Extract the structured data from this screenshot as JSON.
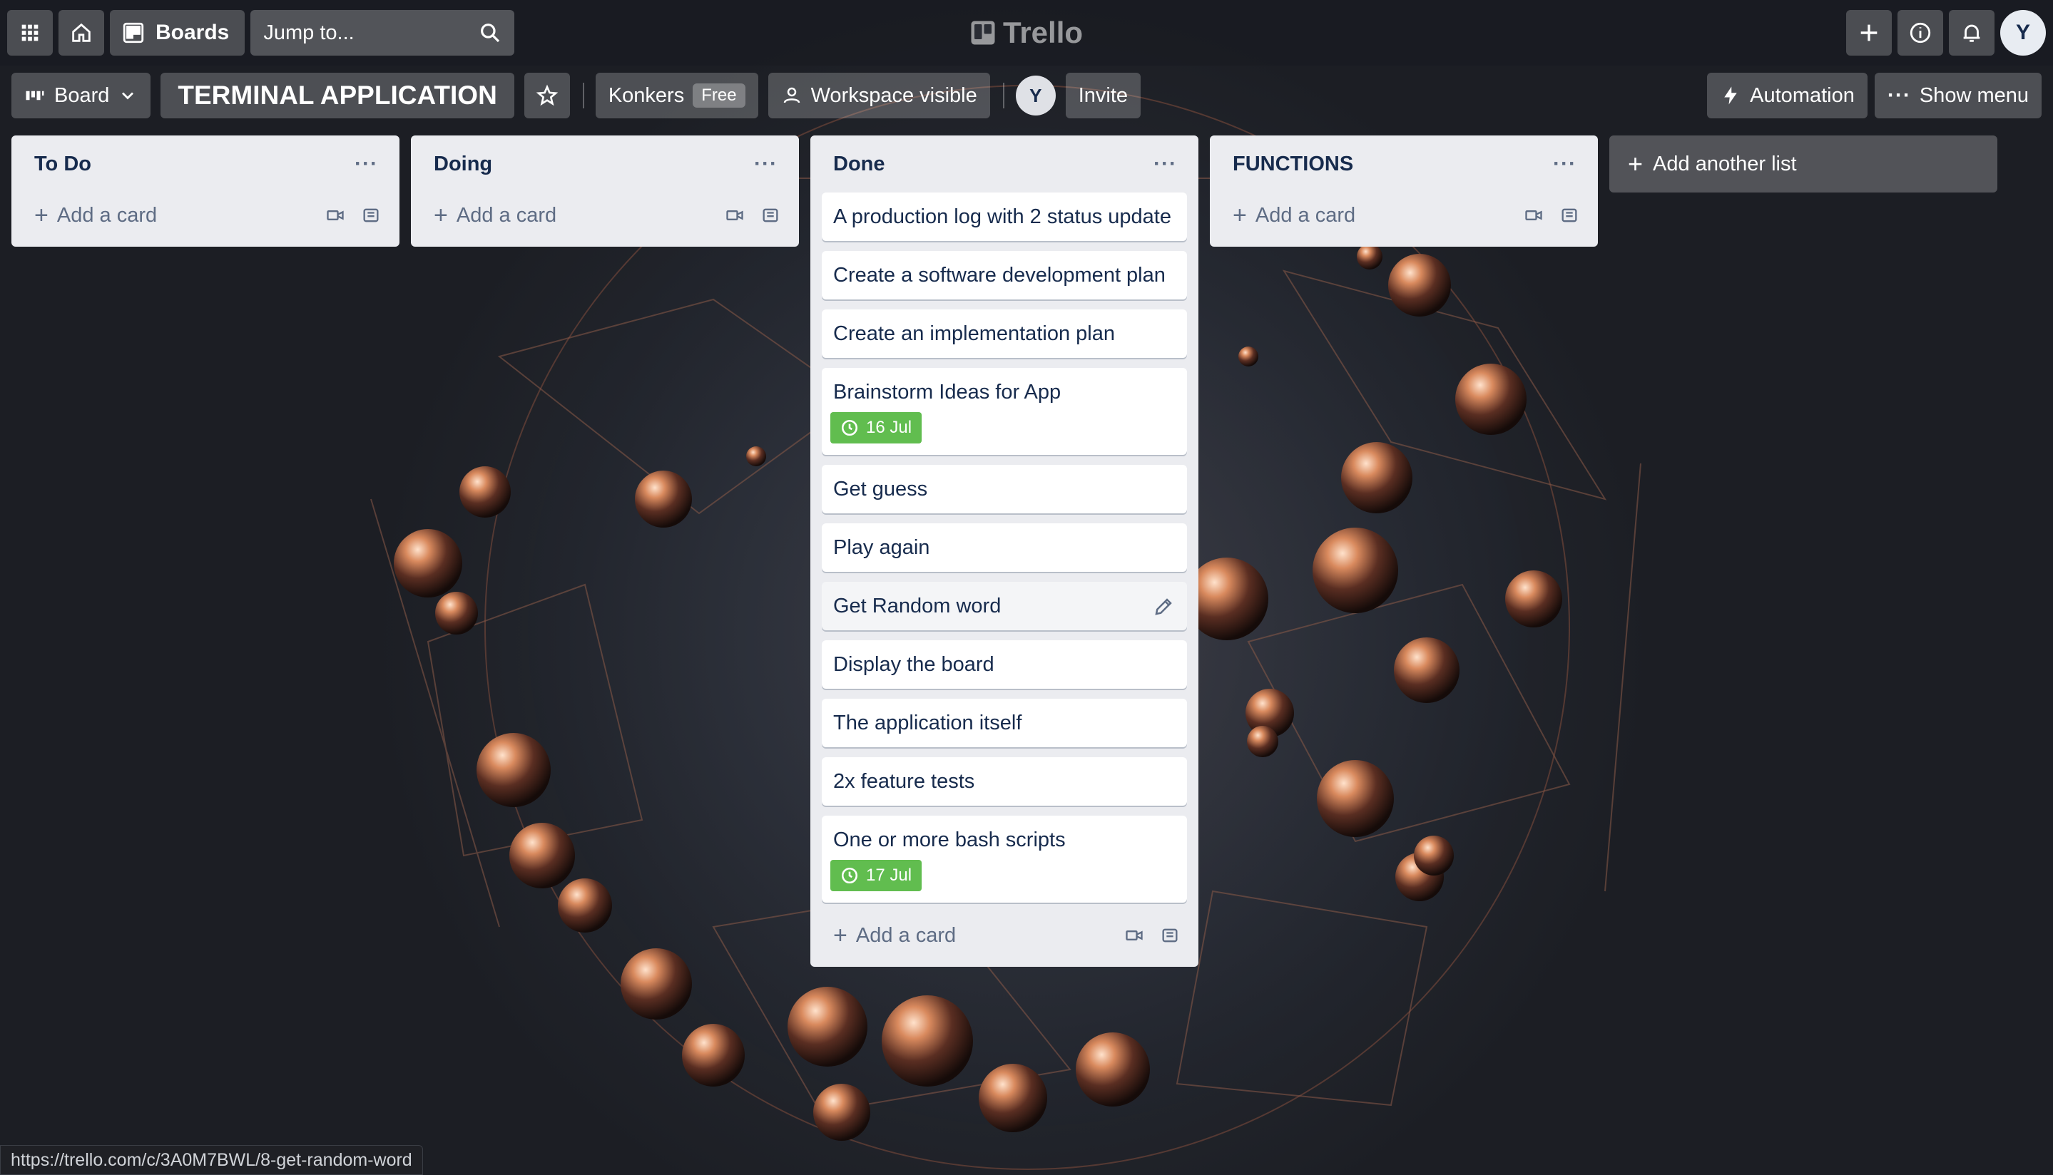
{
  "topbar": {
    "boards_label": "Boards",
    "search_placeholder": "Jump to...",
    "logo_text": "Trello",
    "user_initial": "Y"
  },
  "board": {
    "view_label": "Board",
    "title": "TERMINAL APPLICATION",
    "workspace_name": "Konkers",
    "workspace_plan": "Free",
    "visibility_label": "Workspace visible",
    "member_initial": "Y",
    "invite_label": "Invite",
    "automation_label": "Automation",
    "show_menu_label": "Show menu"
  },
  "lists": {
    "todo": {
      "title": "To Do",
      "add_label": "Add a card"
    },
    "doing": {
      "title": "Doing",
      "add_label": "Add a card"
    },
    "done": {
      "title": "Done",
      "add_label": "Add a card",
      "cards": [
        {
          "title": "A production log with 2 status update"
        },
        {
          "title": "Create a software development plan"
        },
        {
          "title": "Create an implementation plan"
        },
        {
          "title": "Brainstorm Ideas for App",
          "due": "16 Jul"
        },
        {
          "title": "Get guess"
        },
        {
          "title": "Play again"
        },
        {
          "title": "Get Random word"
        },
        {
          "title": "Display the board"
        },
        {
          "title": "The application itself"
        },
        {
          "title": "2x feature tests"
        },
        {
          "title": "One or more bash scripts",
          "due": "17 Jul"
        }
      ]
    },
    "functions": {
      "title": "FUNCTIONS",
      "add_label": "Add a card"
    }
  },
  "add_list_label": "Add another list",
  "status_url": "https://trello.com/c/3A0M7BWL/8-get-random-word",
  "colors": {
    "due_badge": "#61bd4f",
    "list_bg": "#ebecf0",
    "accent": "#0079bf"
  }
}
